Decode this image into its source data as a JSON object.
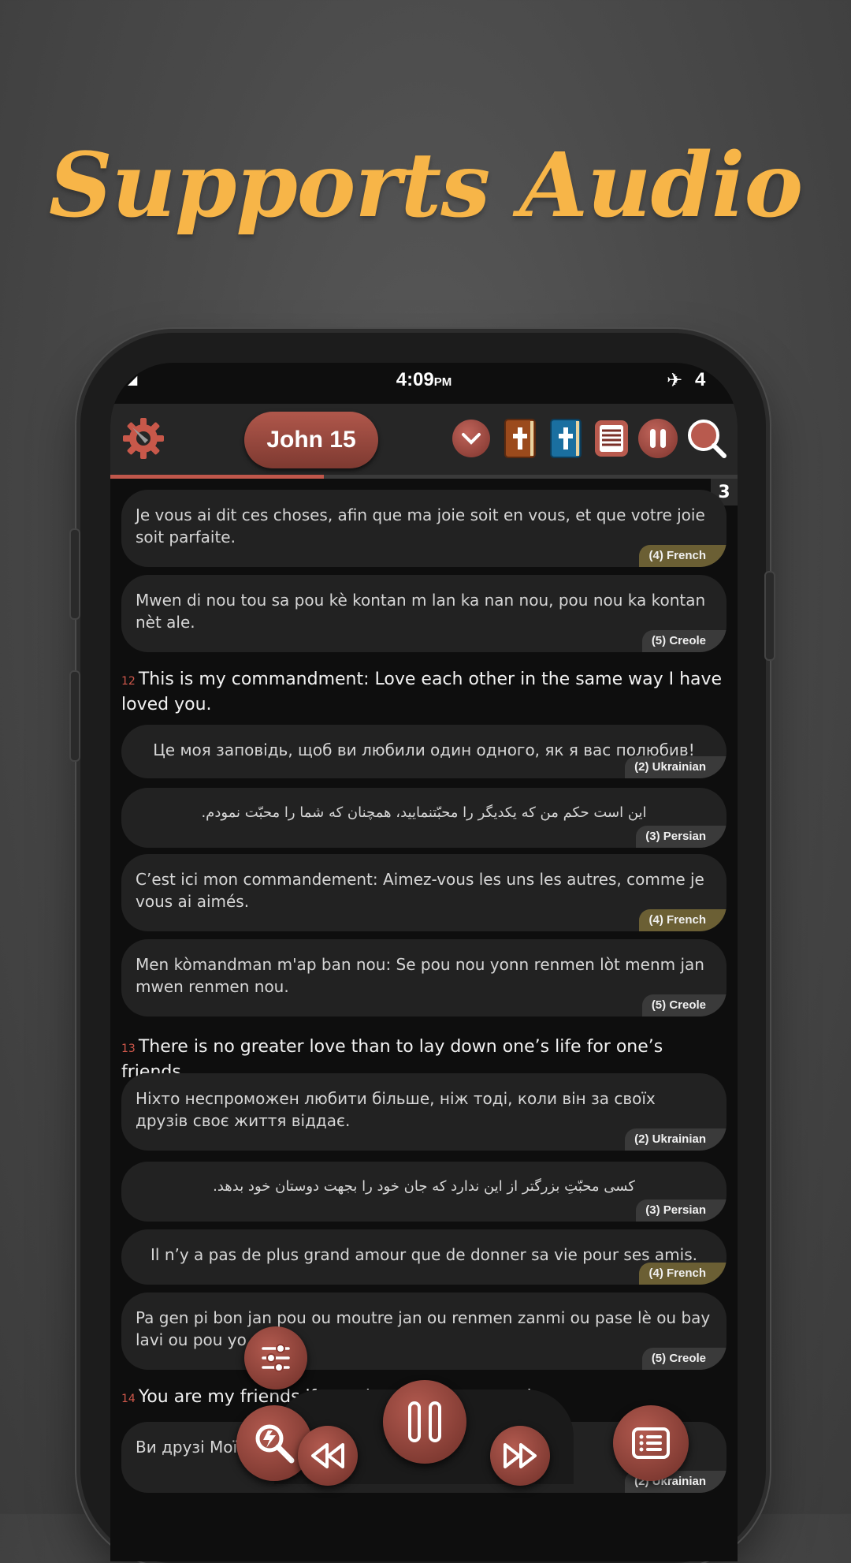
{
  "headline": "Supports Audio",
  "status": {
    "time": "4:09",
    "ampm": "PM",
    "battery": "4",
    "airplane_icon": "airplane-icon"
  },
  "toolbar": {
    "title": "John 15",
    "icons": [
      "settings-wrench-gear-icon",
      "chevron-down-icon",
      "bible-brown-icon",
      "bible-blue-icon",
      "parallel-text-icon",
      "pause-icon",
      "search-icon"
    ],
    "progress": 0.34
  },
  "page_number": "3",
  "items": [
    {
      "type": "card",
      "lang": "(4)  French",
      "text": "Je vous ai dit ces choses, afin que ma joie soit en vous, et que votre joie soit parfaite."
    },
    {
      "type": "card",
      "lang": "(5)  Creole",
      "text": "Mwen di nou tou sa pou kè kontan m lan ka nan nou, pou nou ka kontan nèt ale."
    },
    {
      "type": "verse",
      "num": "12",
      "text": "This is my commandment: Love each other in the same way I have loved you."
    },
    {
      "type": "card",
      "lang": "(2)  Ukrainian",
      "text": "Це моя заповідь, щоб ви любили один одного, як я вас полюбив!"
    },
    {
      "type": "card",
      "lang": "(3)  Persian",
      "text": "این است حکم من که یکدیگر را محبّتنمایید، همچنان که شما را محبّت نمودم."
    },
    {
      "type": "card",
      "lang": "(4)  French",
      "text": "C’est ici mon commandement: Aimez-vous les uns les autres, comme je vous ai aimés."
    },
    {
      "type": "card",
      "lang": "(5)  Creole",
      "text": "Men kòmandman m'ap ban nou: Se pou nou yonn renmen lòt menm jan mwen renmen nou."
    },
    {
      "type": "verse",
      "num": "13",
      "text": "There is no greater love than to lay down one’s life for one’s friends."
    },
    {
      "type": "card",
      "lang": "(2)  Ukrainian",
      "text": "Ніхто неспроможен любити більше, ніж тоді, коли він за своїх друзів своє життя віддає."
    },
    {
      "type": "card",
      "lang": "(3)  Persian",
      "text": "کسی محبّتِ بزرگتر از این ندارد که جان خود را بجهت دوستان خود بدهد."
    },
    {
      "type": "card",
      "lang": "(4)  French",
      "text": "Il n’y a pas de plus grand amour que de donner sa vie pour ses amis."
    },
    {
      "type": "card",
      "lang": "(5)  Creole",
      "text": "Pa gen pi bon jan pou ou moutre jan ou renmen zanmi ou pase lè ou bay lavi ou pou yo."
    },
    {
      "type": "verse",
      "num": "14",
      "text": "You are my friends if you do what I command."
    },
    {
      "type": "card",
      "lang": "(2)  Ukrainian",
      "text": "Ви друзі Мої, якщо чините те, що Я вам заповідаю."
    }
  ],
  "fabs": [
    "filter-sliders-icon",
    "quick-search-icon",
    "rewind-icon",
    "pause-icon",
    "fast-forward-icon",
    "list-icon"
  ]
}
